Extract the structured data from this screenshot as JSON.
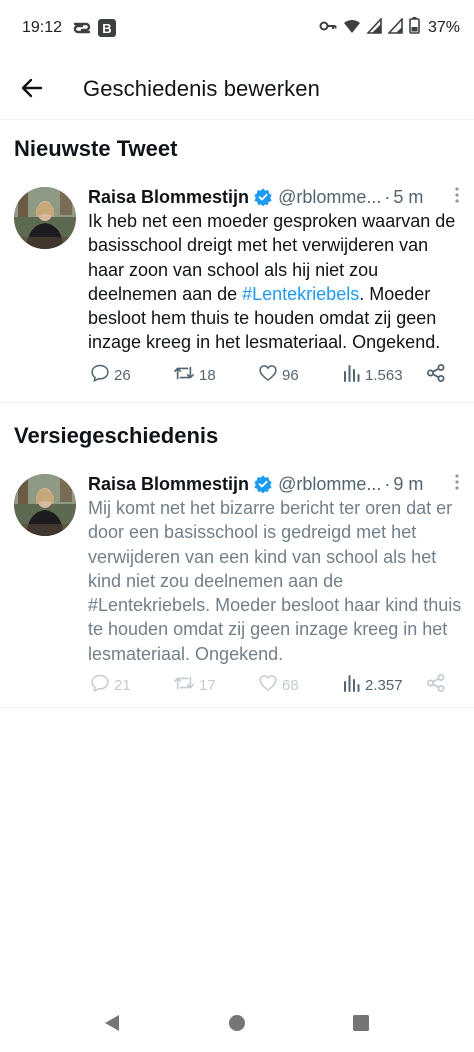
{
  "status_bar": {
    "time": "19:12",
    "battery_percent": "37%",
    "icons": [
      "link-icon",
      "b-app-icon",
      "key-icon",
      "wifi-icon",
      "signal-icon",
      "signal-icon",
      "battery-icon"
    ]
  },
  "header": {
    "title": "Geschiedenis bewerken",
    "back_icon": "arrow-left-icon"
  },
  "latest": {
    "section_title": "Nieuwste Tweet",
    "tweet": {
      "author": "Raisa Blommestijn",
      "handle": "@rblomme...",
      "separator": "·",
      "time": "5 m",
      "text_before": "Ik heb net een moeder gesproken waarvan de basisschool dreigt met het verwijderen van haar zoon van school als hij niet zou deelnemen aan de ",
      "hashtag": "#Lentekriebels",
      "text_after": ". Moeder besloot hem thuis te houden omdat zij geen inzage kreeg in het lesmateriaal. Ongekend.",
      "replies": "26",
      "retweets": "18",
      "likes": "96",
      "views": "1.563"
    }
  },
  "history": {
    "section_title": "Versiegeschiedenis",
    "tweet": {
      "author": "Raisa Blommestijn",
      "handle": "@rblomme...",
      "separator": "·",
      "time": "9 m",
      "text_before": "Mij komt net het bizarre bericht ter oren dat er door een basisschool is gedreigd met het verwijderen van een kind van school als het kind niet zou deelnemen aan de ",
      "hashtag": "#Lentekriebels",
      "text_after": ". Moeder besloot haar kind thuis te houden omdat zij geen inzage kreeg in het lesmateriaal. Ongekend.",
      "replies": "21",
      "retweets": "17",
      "likes": "68",
      "views": "2.357"
    }
  },
  "colors": {
    "accent": "#1d9bf0",
    "text": "#0f1419",
    "secondary": "#536471",
    "faded": "#c4ccd2",
    "divider": "#eff3f4"
  },
  "nav_bar": {
    "icons": [
      "back-triangle-icon",
      "home-circle-icon",
      "recents-square-icon"
    ]
  }
}
